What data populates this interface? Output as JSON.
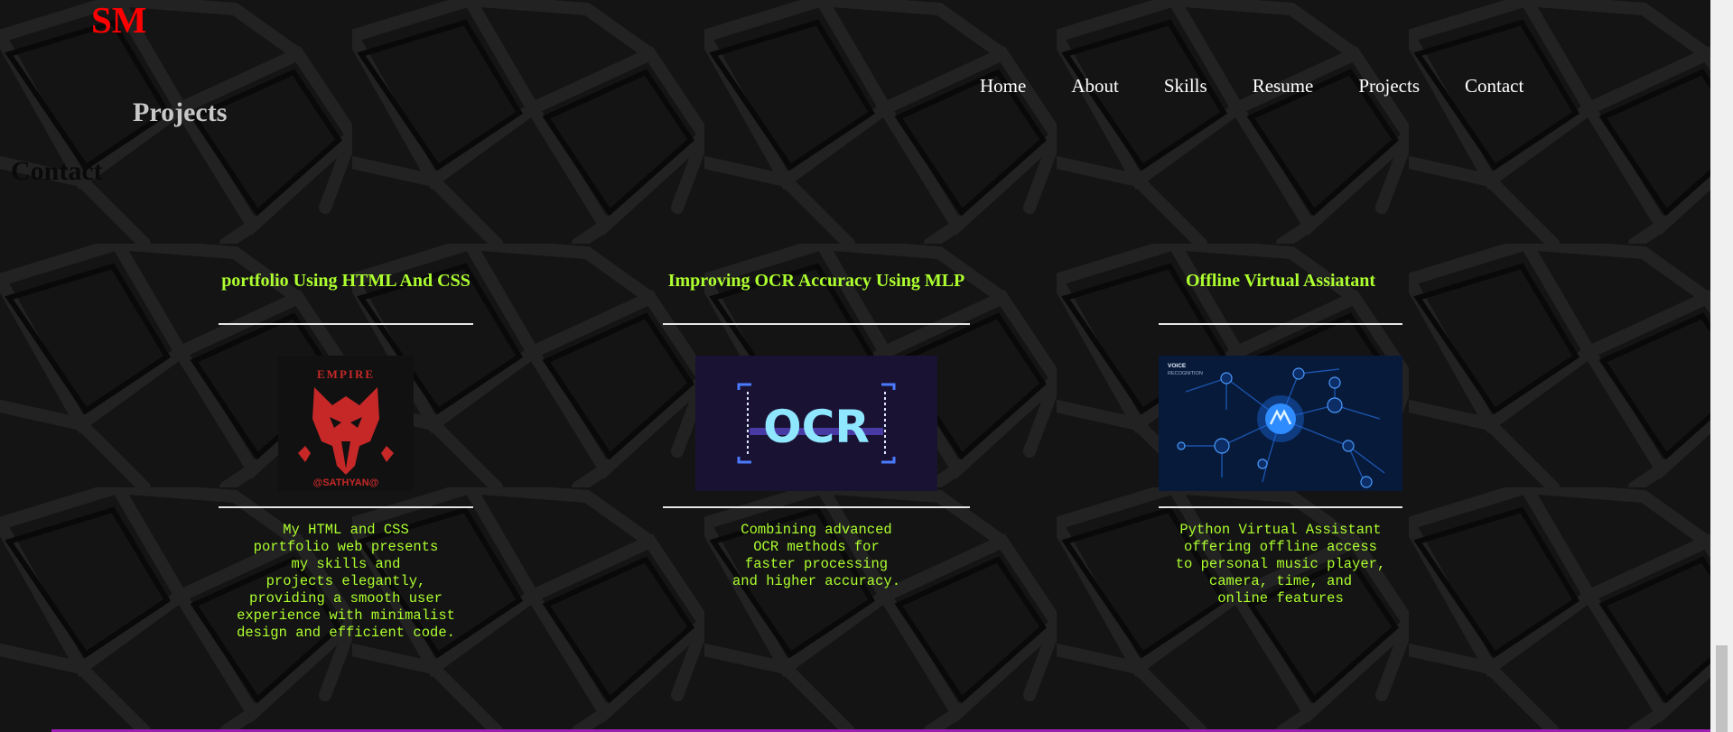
{
  "brand": {
    "logo": "SM"
  },
  "headings": {
    "section": "Projects",
    "ghost": "Contact"
  },
  "nav": {
    "items": [
      "Home",
      "About",
      "Skills",
      "Resume",
      "Projects",
      "Contact"
    ]
  },
  "projects": [
    {
      "title": "portfolio Using HTML And CSS",
      "thumbnail_icon": "empire-wolf-logo",
      "thumbnail_top_text": "EMPIRE",
      "thumbnail_bottom_text": "@SATHYAN@",
      "description": "My HTML and CSS\nportfolio web presents\nmy skills and\nprojects elegantly,\nproviding a smooth user\nexperience with minimalist\ndesign and efficient code."
    },
    {
      "title": "Improving OCR Accuracy Using MLP",
      "thumbnail_icon": "ocr-scan-icon",
      "thumbnail_text": "OCR",
      "description": "Combining advanced\nOCR methods for\nfaster processing\nand higher accuracy."
    },
    {
      "title": "Offline Virtual Assiatant",
      "thumbnail_icon": "voice-recognition-network",
      "thumbnail_label": "VOICE\nRECOGNITION",
      "description": "Python Virtual Assistant\noffering offline access\nto personal music player,\ncamera, time, and\nonline features"
    }
  ],
  "colors": {
    "logo": "#ff0000",
    "accent": "#adff2f",
    "nav_text": "#ffffff",
    "background": "#141414",
    "bottom_border": "#9b1fb0"
  }
}
